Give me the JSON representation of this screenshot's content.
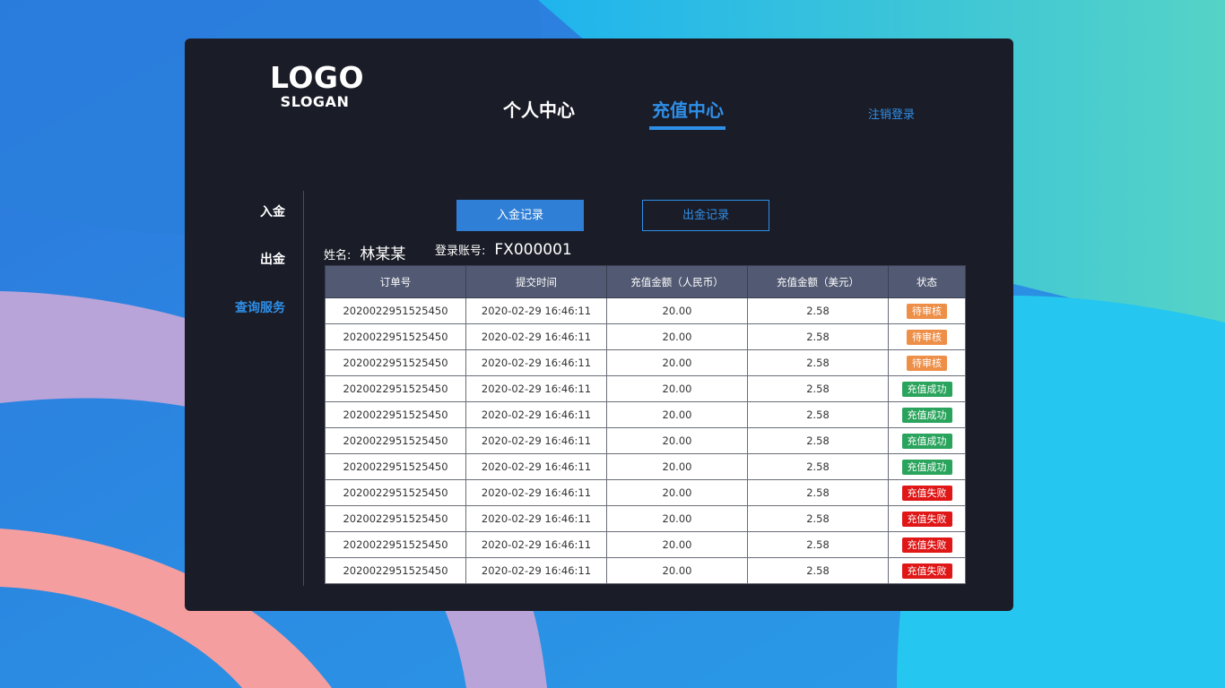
{
  "logo": {
    "text": "LOGO",
    "slogan": "SLOGAN"
  },
  "nav": {
    "tabs": [
      {
        "label": "个人中心",
        "active": false
      },
      {
        "label": "充值中心",
        "active": true
      }
    ],
    "logout": "注销登录"
  },
  "sidebar": {
    "items": [
      {
        "label": "入金",
        "active": false
      },
      {
        "label": "出金",
        "active": false
      },
      {
        "label": "查询服务",
        "active": true
      }
    ]
  },
  "actions": {
    "deposit_records": "入金记录",
    "withdraw_records": "出金记录"
  },
  "user": {
    "name_label": "姓名:",
    "name": "林某某",
    "account_label": "登录账号:",
    "account": "FX000001"
  },
  "table": {
    "headers": [
      "订单号",
      "提交时间",
      "充值金额（人民币）",
      "充值金额（美元）",
      "状态"
    ],
    "rows": [
      {
        "order": "2020022951525450",
        "time": "2020-02-29 16:46:11",
        "cny": "20.00",
        "usd": "2.58",
        "status": "待审核",
        "status_type": "pending"
      },
      {
        "order": "2020022951525450",
        "time": "2020-02-29 16:46:11",
        "cny": "20.00",
        "usd": "2.58",
        "status": "待审核",
        "status_type": "pending"
      },
      {
        "order": "2020022951525450",
        "time": "2020-02-29 16:46:11",
        "cny": "20.00",
        "usd": "2.58",
        "status": "待审核",
        "status_type": "pending"
      },
      {
        "order": "2020022951525450",
        "time": "2020-02-29 16:46:11",
        "cny": "20.00",
        "usd": "2.58",
        "status": "充值成功",
        "status_type": "success"
      },
      {
        "order": "2020022951525450",
        "time": "2020-02-29 16:46:11",
        "cny": "20.00",
        "usd": "2.58",
        "status": "充值成功",
        "status_type": "success"
      },
      {
        "order": "2020022951525450",
        "time": "2020-02-29 16:46:11",
        "cny": "20.00",
        "usd": "2.58",
        "status": "充值成功",
        "status_type": "success"
      },
      {
        "order": "2020022951525450",
        "time": "2020-02-29 16:46:11",
        "cny": "20.00",
        "usd": "2.58",
        "status": "充值成功",
        "status_type": "success"
      },
      {
        "order": "2020022951525450",
        "time": "2020-02-29 16:46:11",
        "cny": "20.00",
        "usd": "2.58",
        "status": "充值失败",
        "status_type": "failed"
      },
      {
        "order": "2020022951525450",
        "time": "2020-02-29 16:46:11",
        "cny": "20.00",
        "usd": "2.58",
        "status": "充值失败",
        "status_type": "failed"
      },
      {
        "order": "2020022951525450",
        "time": "2020-02-29 16:46:11",
        "cny": "20.00",
        "usd": "2.58",
        "status": "充值失败",
        "status_type": "failed"
      },
      {
        "order": "2020022951525450",
        "time": "2020-02-29 16:46:11",
        "cny": "20.00",
        "usd": "2.58",
        "status": "充值失败",
        "status_type": "failed"
      }
    ]
  },
  "colors": {
    "accent": "#2f8fe8",
    "panel": "#1a1c27",
    "header_bg": "#525a73",
    "pending": "#ee8f48",
    "success": "#2aa45c",
    "failed": "#df1717"
  }
}
